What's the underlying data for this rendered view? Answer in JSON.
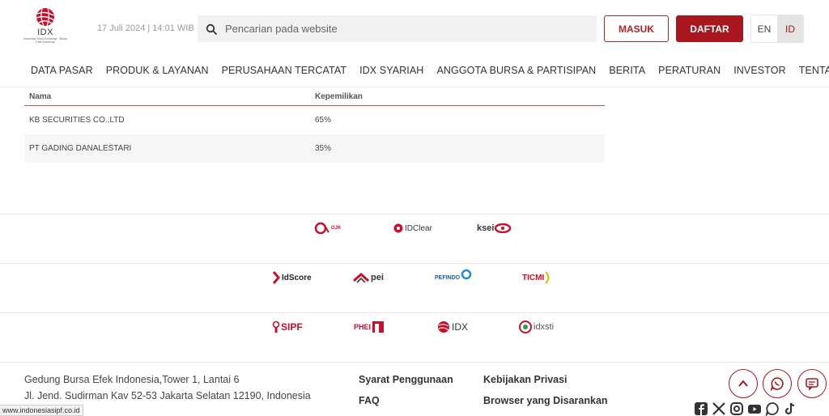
{
  "header": {
    "logo_text": "IDX",
    "logo_sub": "Indonesia Stock Exchange · Bursa Efek Indonesia",
    "datetime": "17 Juli 2024  |  14:01 WIB",
    "search_placeholder": "Pencarian pada website",
    "masuk": "MASUK",
    "daftar": "DAFTAR",
    "lang_en": "EN",
    "lang_id": "ID",
    "active_lang_color": "#a8171d",
    "brand_color": "#a8171d"
  },
  "nav": [
    "DATA PASAR",
    "PRODUK & LAYANAN",
    "PERUSAHAAN TERCATAT",
    "IDX SYARIAH",
    "ANGGOTA BURSA & PARTISIPAN",
    "BERITA",
    "PERATURAN",
    "INVESTOR",
    "TENTANG BEI"
  ],
  "table": {
    "headers": [
      "Nama",
      "Kepemilikan"
    ],
    "rows": [
      [
        "KB SECURITIES CO.,LTD",
        "65%"
      ],
      [
        "PT GADING DANALESTARI",
        "35%"
      ]
    ]
  },
  "partners": {
    "row1": [
      "OJK",
      "IDClear",
      "ksei"
    ],
    "row2": [
      "IdScore",
      "pei",
      "PEFINDO",
      "TICMI"
    ],
    "row3": [
      "SIPF",
      "PHEI",
      "IDX",
      "idxsti"
    ]
  },
  "footer": {
    "address_line1": "Gedung Bursa Efek Indonesia,Tower 1, Lantai 6",
    "address_line2": "Jl. Jend. Sudirman Kav 52-53 Jakarta Selatan 12190, Indonesia",
    "links": [
      "Syarat Penggunaan",
      "Kebijakan Privasi",
      "FAQ",
      "Browser yang Disarankan"
    ],
    "floating_buttons": [
      "chevron-up-icon",
      "whatsapp-icon",
      "chat-icon"
    ],
    "social_icons": [
      "facebook-icon",
      "x-icon",
      "instagram-icon",
      "youtube-icon",
      "whatsapp-icon",
      "tiktok-icon"
    ]
  },
  "status_url": "www.indonesiasipf.co.id"
}
